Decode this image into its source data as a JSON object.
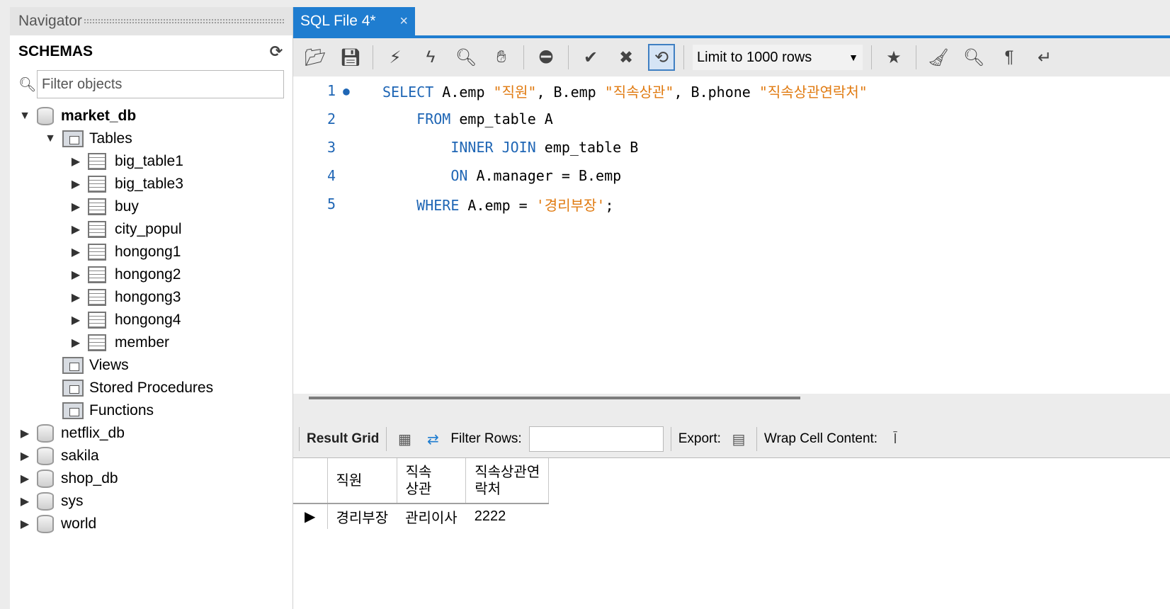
{
  "navigator": {
    "title": "Navigator",
    "schemas_label": "SCHEMAS",
    "filter_placeholder": "Filter objects",
    "tree": {
      "market_db": {
        "name": "market_db",
        "tables_label": "Tables",
        "tables": [
          "big_table1",
          "big_table3",
          "buy",
          "city_popul",
          "hongong1",
          "hongong2",
          "hongong3",
          "hongong4",
          "member"
        ],
        "views_label": "Views",
        "procs_label": "Stored Procedures",
        "functions_label": "Functions"
      },
      "others": [
        "netflix_db",
        "sakila",
        "shop_db",
        "sys",
        "world"
      ]
    }
  },
  "tab": {
    "label": "SQL File 4*",
    "close": "×"
  },
  "toolbar": {
    "limit_label": "Limit to 1000 rows"
  },
  "editor": {
    "lines": [
      {
        "num": "1",
        "marker": "●",
        "indent": "",
        "tokens": [
          {
            "t": "SELECT",
            "c": "kw"
          },
          {
            "t": " A.emp ",
            "c": ""
          },
          {
            "t": "\"직원\"",
            "c": "str"
          },
          {
            "t": ", B.emp ",
            "c": ""
          },
          {
            "t": "\"직속상관\"",
            "c": "str"
          },
          {
            "t": ", B.phone ",
            "c": ""
          },
          {
            "t": "\"직속상관연락처\"",
            "c": "str"
          }
        ]
      },
      {
        "num": "2",
        "marker": "",
        "indent": "    ",
        "tokens": [
          {
            "t": "FROM",
            "c": "kw"
          },
          {
            "t": " emp_table A",
            "c": ""
          }
        ]
      },
      {
        "num": "3",
        "marker": "",
        "indent": "        ",
        "tokens": [
          {
            "t": "INNER",
            "c": "kw"
          },
          {
            "t": " ",
            "c": ""
          },
          {
            "t": "JOIN",
            "c": "kw"
          },
          {
            "t": " emp_table B",
            "c": ""
          }
        ]
      },
      {
        "num": "4",
        "marker": "",
        "indent": "        ",
        "tokens": [
          {
            "t": "ON",
            "c": "kw"
          },
          {
            "t": " A.manager = B.emp",
            "c": ""
          }
        ]
      },
      {
        "num": "5",
        "marker": "",
        "indent": "    ",
        "tokens": [
          {
            "t": "WHERE",
            "c": "kw"
          },
          {
            "t": " A.emp = ",
            "c": ""
          },
          {
            "t": "'경리부장'",
            "c": "str"
          },
          {
            "t": ";",
            "c": ""
          }
        ]
      }
    ]
  },
  "result_toolbar": {
    "result_grid": "Result Grid",
    "filter_rows": "Filter Rows:",
    "export": "Export:",
    "wrap": "Wrap Cell Content:"
  },
  "result": {
    "columns": [
      "직원",
      "직속\n상관",
      "직속상관연\n락처"
    ],
    "rows": [
      [
        "경리부장",
        "관리이사",
        "2222"
      ]
    ]
  },
  "colors": {
    "accent": "#1f7dd0",
    "keyword": "#1f66b5",
    "string": "#e07a10"
  }
}
